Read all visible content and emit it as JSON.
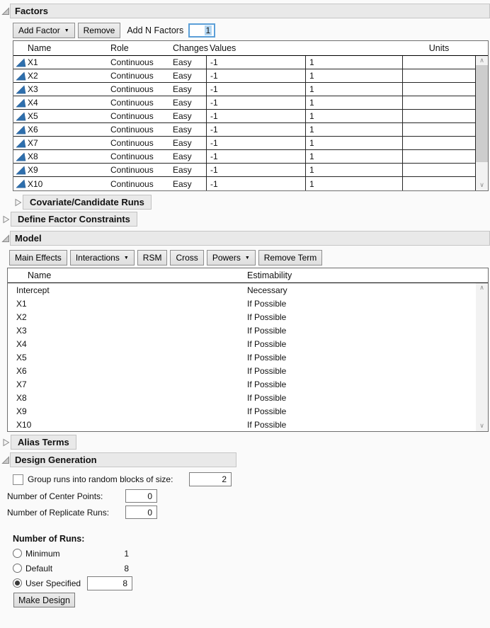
{
  "icons": {
    "dropdown_arrow": "▼",
    "chevron_up": "∧",
    "chevron_down": "∨"
  },
  "colors": {
    "continuous_icon_blue": "#2e6fad",
    "focus_border_blue": "#5b9fd8",
    "selection_highlight": "#b3d6f2",
    "section_header_bg": "#e9e9e9"
  },
  "factors": {
    "title": "Factors",
    "toolbar": {
      "add_factor_label": "Add Factor",
      "remove_label": "Remove",
      "add_n_label": "Add N Factors",
      "add_n_value": "1"
    },
    "table": {
      "headers": {
        "name": "Name",
        "role": "Role",
        "changes": "Changes",
        "values": "Values",
        "units": "Units"
      },
      "rows": [
        {
          "name": "X1",
          "role": "Continuous",
          "changes": "Easy",
          "low": "-1",
          "high": "1",
          "units": ""
        },
        {
          "name": "X2",
          "role": "Continuous",
          "changes": "Easy",
          "low": "-1",
          "high": "1",
          "units": ""
        },
        {
          "name": "X3",
          "role": "Continuous",
          "changes": "Easy",
          "low": "-1",
          "high": "1",
          "units": ""
        },
        {
          "name": "X4",
          "role": "Continuous",
          "changes": "Easy",
          "low": "-1",
          "high": "1",
          "units": ""
        },
        {
          "name": "X5",
          "role": "Continuous",
          "changes": "Easy",
          "low": "-1",
          "high": "1",
          "units": ""
        },
        {
          "name": "X6",
          "role": "Continuous",
          "changes": "Easy",
          "low": "-1",
          "high": "1",
          "units": ""
        },
        {
          "name": "X7",
          "role": "Continuous",
          "changes": "Easy",
          "low": "-1",
          "high": "1",
          "units": ""
        },
        {
          "name": "X8",
          "role": "Continuous",
          "changes": "Easy",
          "low": "-1",
          "high": "1",
          "units": ""
        },
        {
          "name": "X9",
          "role": "Continuous",
          "changes": "Easy",
          "low": "-1",
          "high": "1",
          "units": ""
        },
        {
          "name": "X10",
          "role": "Continuous",
          "changes": "Easy",
          "low": "-1",
          "high": "1",
          "units": ""
        }
      ]
    }
  },
  "covariate": {
    "title": "Covariate/Candidate Runs"
  },
  "constraints": {
    "title": "Define Factor Constraints"
  },
  "model": {
    "title": "Model",
    "toolbar": [
      {
        "label": "Main Effects",
        "dropdown": false
      },
      {
        "label": "Interactions",
        "dropdown": true
      },
      {
        "label": "RSM",
        "dropdown": false
      },
      {
        "label": "Cross",
        "dropdown": false
      },
      {
        "label": "Powers",
        "dropdown": true
      },
      {
        "label": "Remove Term",
        "dropdown": false
      }
    ],
    "table": {
      "headers": {
        "name": "Name",
        "estimability": "Estimability"
      },
      "rows": [
        {
          "name": "Intercept",
          "estimability": "Necessary"
        },
        {
          "name": "X1",
          "estimability": "If Possible"
        },
        {
          "name": "X2",
          "estimability": "If Possible"
        },
        {
          "name": "X3",
          "estimability": "If Possible"
        },
        {
          "name": "X4",
          "estimability": "If Possible"
        },
        {
          "name": "X5",
          "estimability": "If Possible"
        },
        {
          "name": "X6",
          "estimability": "If Possible"
        },
        {
          "name": "X7",
          "estimability": "If Possible"
        },
        {
          "name": "X8",
          "estimability": "If Possible"
        },
        {
          "name": "X9",
          "estimability": "If Possible"
        },
        {
          "name": "X10",
          "estimability": "If Possible"
        }
      ]
    }
  },
  "alias": {
    "title": "Alias Terms"
  },
  "design": {
    "title": "Design Generation",
    "group_blocks": {
      "label": "Group runs into random blocks of size:",
      "value": "2",
      "checked": false
    },
    "center_points": {
      "label": "Number of Center Points:",
      "value": "0"
    },
    "replicate_runs": {
      "label": "Number of Replicate Runs:",
      "value": "0"
    },
    "number_of_runs": {
      "label": "Number of Runs:",
      "options": [
        {
          "label": "Minimum",
          "value": "1",
          "selected": false,
          "boxed": false
        },
        {
          "label": "Default",
          "value": "8",
          "selected": false,
          "boxed": false
        },
        {
          "label": "User Specified",
          "value": "8",
          "selected": true,
          "boxed": true
        }
      ]
    },
    "make_design_label": "Make Design"
  }
}
